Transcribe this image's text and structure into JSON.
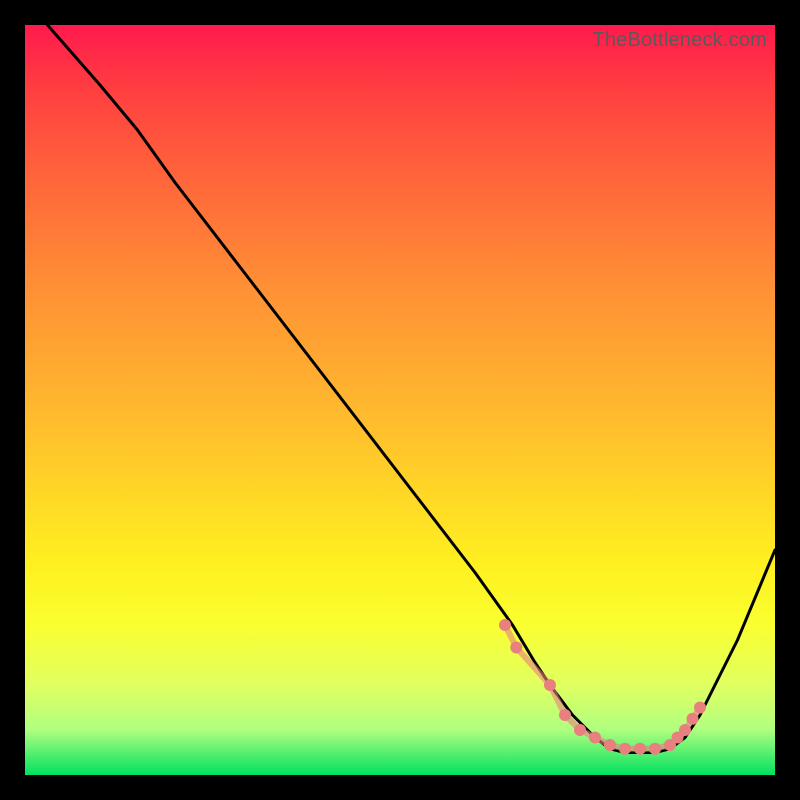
{
  "attribution": "TheBottleneck.com",
  "chart_data": {
    "type": "line",
    "title": "",
    "xlabel": "",
    "ylabel": "",
    "xlim": [
      0,
      100
    ],
    "ylim": [
      0,
      100
    ],
    "legend": false,
    "grid": false,
    "background_gradient": [
      "#ff1a4d",
      "#ff6a3a",
      "#ffd028",
      "#faff30",
      "#00e060"
    ],
    "series": [
      {
        "name": "bottleneck-curve",
        "stroke": "#000000",
        "x": [
          3,
          10,
          15,
          20,
          30,
          40,
          50,
          60,
          65,
          68,
          70,
          73,
          76,
          78,
          80,
          82,
          84,
          86,
          88,
          90,
          95,
          100
        ],
        "y": [
          100,
          92,
          86,
          79,
          66,
          53,
          40,
          27,
          20,
          15,
          12,
          8,
          5,
          3.5,
          3,
          3,
          3,
          3.5,
          5,
          8,
          18,
          30
        ]
      },
      {
        "name": "optimal-range-markers",
        "type": "scatter",
        "stroke": "#e98080",
        "fill": "#e98080",
        "x": [
          64,
          65.5,
          70,
          72,
          74,
          76,
          78,
          80,
          82,
          84,
          86,
          87,
          88,
          89,
          90
        ],
        "y": [
          20,
          17,
          12,
          8,
          6,
          5,
          4,
          3.5,
          3.5,
          3.5,
          4,
          5,
          6,
          7.5,
          9
        ]
      }
    ]
  }
}
